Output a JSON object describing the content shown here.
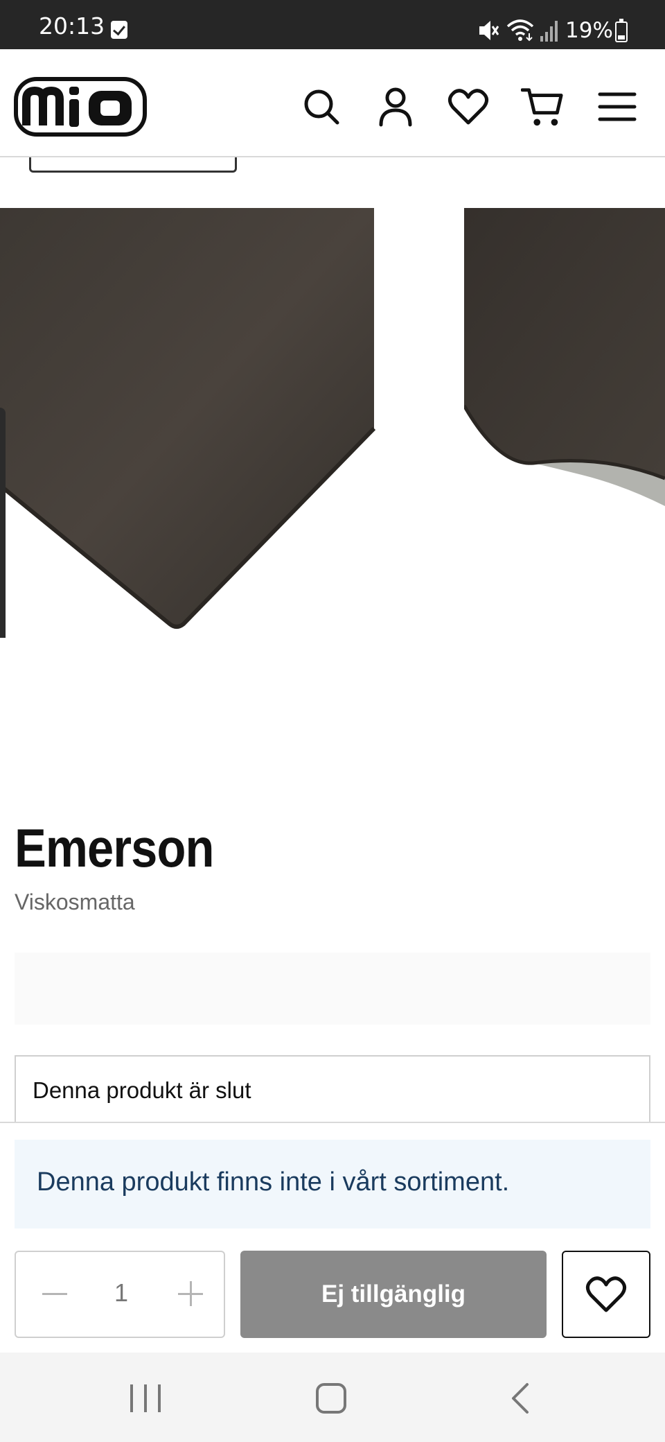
{
  "status_bar": {
    "time": "20:13",
    "battery": "19%"
  },
  "header": {
    "logo_text": "mio",
    "icons": [
      "search-icon",
      "user-icon",
      "heart-icon",
      "cart-icon",
      "menu-icon"
    ]
  },
  "product": {
    "title": "Emerson",
    "subtitle": "Viskosmatta",
    "out_of_stock_label": "Denna produkt är slut"
  },
  "sticky": {
    "notice": "Denna produkt finns inte i vårt sortiment.",
    "quantity": "1",
    "unavailable_label": "Ej tillgänglig"
  },
  "colors": {
    "rug": "#3b3632",
    "notice_bg": "#f1f7fc",
    "notice_text": "#1a3b5e",
    "disabled_button": "#8a8a8a"
  }
}
